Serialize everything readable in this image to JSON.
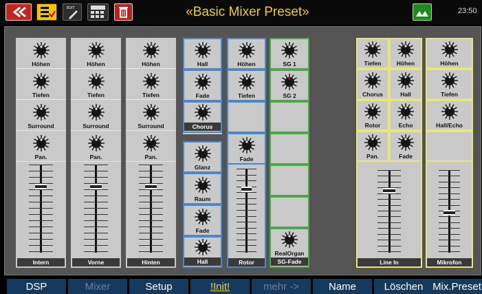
{
  "header": {
    "title": "«Basic Mixer Preset»",
    "clock": "23:50",
    "icons": [
      "back-icon",
      "menu-icon",
      "edit-icon",
      "keypad-icon",
      "trash-icon",
      "shift-icon"
    ]
  },
  "colors": {
    "group_blue": "#4f86c7",
    "group_green": "#4ca64c",
    "group_yellow": "#e7e67c",
    "title_yellow": "#f2cc2a",
    "fkey_bg": "#163a5e"
  },
  "mixer": {
    "channels": [
      {
        "knobs": [
          "Höhen",
          "Tiefen",
          "Surround",
          "Pan."
        ],
        "name": "Intern",
        "level": 0.77
      },
      {
        "knobs": [
          "Höhen",
          "Tiefen",
          "Surround",
          "Pan."
        ],
        "name": "Vorne",
        "level": 0.77
      },
      {
        "knobs": [
          "Höhen",
          "Tiefen",
          "Surround",
          "Pan."
        ],
        "name": "Hinten",
        "level": 0.77
      },
      {
        "knobs": [
          "Hall",
          "Fade",
          "Chorus",
          "Glanz",
          "Raum",
          "Fade"
        ],
        "name": "Hall"
      },
      {
        "knobs": [
          "Höhen",
          "Tiefen",
          "Fade"
        ],
        "name": "Rotor",
        "level": 0.77
      },
      {
        "knobs": [
          "SG 1",
          "SG 2",
          "RealOrgan"
        ],
        "name": "SG-Fade"
      },
      {
        "knobs_left": [
          "Tiefen",
          "Chorus",
          "Rotor",
          "Pan."
        ],
        "knobs_right": [
          "Höhen",
          "Hall",
          "Echo",
          "Fade"
        ],
        "name": "Line In",
        "level": 0.77
      },
      {
        "knobs": [
          "Höhen",
          "Tiefen",
          "Hall/Echo"
        ],
        "name": "Mikrofon",
        "level": 0.48
      }
    ]
  },
  "softkeys": [
    {
      "label": "DSP"
    },
    {
      "label": "Mixer"
    },
    {
      "label": "Setup"
    },
    {
      "label": "!Init!"
    },
    {
      "label": "mehr ->"
    },
    {
      "label": "Name"
    },
    {
      "label": "Löschen"
    },
    {
      "label": "Mix.Preset"
    }
  ]
}
